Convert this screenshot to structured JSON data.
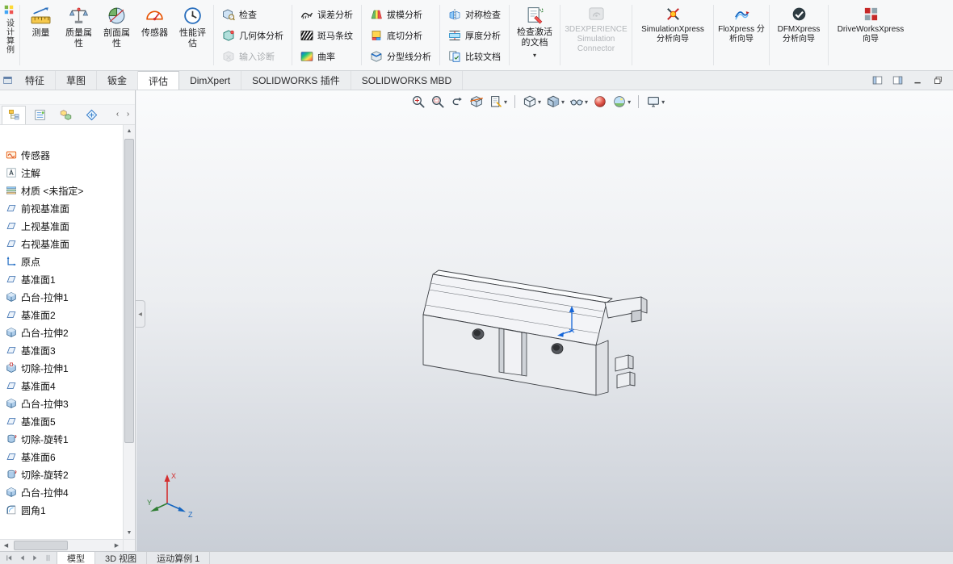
{
  "ribbon": {
    "design_study": {
      "label": "设计算例",
      "icon": "design-study"
    },
    "large_buttons": [
      {
        "label": "测量",
        "icon": "measure"
      },
      {
        "label": "质量属性",
        "icon": "mass-properties"
      },
      {
        "label": "剖面属性",
        "icon": "section-properties"
      },
      {
        "label": "传感器",
        "icon": "sensor"
      },
      {
        "label": "性能评估",
        "icon": "performance-evaluation"
      }
    ],
    "small_groups": [
      {
        "buttons": [
          {
            "label": "检查",
            "icon": "check-entity",
            "disabled": false
          },
          {
            "label": "几何体分析",
            "icon": "geometry-analysis",
            "disabled": false
          },
          {
            "label": "输入诊断",
            "icon": "import-diagnostics",
            "disabled": true
          }
        ]
      },
      {
        "buttons": [
          {
            "label": "误差分析",
            "icon": "deviation-analysis",
            "disabled": false
          },
          {
            "label": "斑马条纹",
            "icon": "zebra-stripes",
            "disabled": false
          },
          {
            "label": "曲率",
            "icon": "curvature",
            "disabled": false
          }
        ]
      },
      {
        "buttons": [
          {
            "label": "拔模分析",
            "icon": "draft-analysis",
            "disabled": false
          },
          {
            "label": "底切分析",
            "icon": "undercut-analysis",
            "disabled": false
          },
          {
            "label": "分型线分析",
            "icon": "parting-line-analysis",
            "disabled": false
          }
        ]
      },
      {
        "buttons": [
          {
            "label": "对称检查",
            "icon": "symmetry-check",
            "disabled": false
          },
          {
            "label": "厚度分析",
            "icon": "thickness-analysis",
            "disabled": false
          },
          {
            "label": "比较文档",
            "icon": "compare-documents",
            "disabled": false
          }
        ]
      }
    ],
    "check_active_document": {
      "label": "检查激活的文档",
      "icon": "check-active-document"
    },
    "wide_buttons": [
      {
        "label": "3DEXPERIENCE Simulation Connector",
        "icon": "threedexperience",
        "disabled": true
      },
      {
        "label": "SimulationXpress 分析向导",
        "icon": "simulationxpress",
        "disabled": false
      },
      {
        "label": "FloXpress 分析向导",
        "icon": "floxpress",
        "disabled": false
      },
      {
        "label": "DFMXpress 分析向导",
        "icon": "dfmxpress",
        "disabled": false
      },
      {
        "label": "DriveWorksXpress 向导",
        "icon": "driveworksxpress",
        "disabled": false
      }
    ]
  },
  "command_tabs": {
    "items": [
      {
        "label": "特征",
        "active": false
      },
      {
        "label": "草图",
        "active": false
      },
      {
        "label": "钣金",
        "active": false
      },
      {
        "label": "评估",
        "active": true
      },
      {
        "label": "DimXpert",
        "active": false
      },
      {
        "label": "SOLIDWORKS 插件",
        "active": false
      },
      {
        "label": "SOLIDWORKS MBD",
        "active": false
      }
    ],
    "window_controls": [
      {
        "icon": "pane-left"
      },
      {
        "icon": "pane-right"
      },
      {
        "icon": "minimize"
      },
      {
        "icon": "restore"
      }
    ]
  },
  "feature_tree": {
    "manager_tabs": [
      {
        "icon": "featuremanager",
        "active": true
      },
      {
        "icon": "propertymanager",
        "active": false
      },
      {
        "icon": "configurationmanager",
        "active": false
      },
      {
        "icon": "dimxpertmanager",
        "active": false
      }
    ],
    "nav_left": "‹",
    "nav_right": "›",
    "items": [
      {
        "label": "传感器",
        "icon": "sensors"
      },
      {
        "label": "注解",
        "icon": "annotations"
      },
      {
        "label": "材质 <未指定>",
        "icon": "material"
      },
      {
        "label": "前视基准面",
        "icon": "plane"
      },
      {
        "label": "上视基准面",
        "icon": "plane"
      },
      {
        "label": "右视基准面",
        "icon": "plane"
      },
      {
        "label": "原点",
        "icon": "origin"
      },
      {
        "label": "基准面1",
        "icon": "plane"
      },
      {
        "label": "凸台-拉伸1",
        "icon": "boss-extrude"
      },
      {
        "label": "基准面2",
        "icon": "plane"
      },
      {
        "label": "凸台-拉伸2",
        "icon": "boss-extrude"
      },
      {
        "label": "基准面3",
        "icon": "plane"
      },
      {
        "label": "切除-拉伸1",
        "icon": "cut-extrude"
      },
      {
        "label": "基准面4",
        "icon": "plane"
      },
      {
        "label": "凸台-拉伸3",
        "icon": "boss-extrude"
      },
      {
        "label": "基准面5",
        "icon": "plane"
      },
      {
        "label": "切除-旋转1",
        "icon": "cut-revolve"
      },
      {
        "label": "基准面6",
        "icon": "plane"
      },
      {
        "label": "切除-旋转2",
        "icon": "cut-revolve"
      },
      {
        "label": "凸台-拉伸4",
        "icon": "boss-extrude"
      },
      {
        "label": "圆角1",
        "icon": "fillet"
      }
    ]
  },
  "viewport": {
    "hud": [
      {
        "icon": "zoom-to-fit",
        "caret": false,
        "sep_after": false
      },
      {
        "icon": "zoom-to-area",
        "caret": false,
        "sep_after": false
      },
      {
        "icon": "previous-view",
        "caret": false,
        "sep_after": false
      },
      {
        "icon": "section-view",
        "caret": false,
        "sep_after": false
      },
      {
        "icon": "drawing-view",
        "caret": true,
        "sep_after": true
      },
      {
        "icon": "view-orientation",
        "caret": true,
        "sep_after": false
      },
      {
        "icon": "display-style",
        "caret": true,
        "sep_after": false
      },
      {
        "icon": "hide-show-items",
        "caret": true,
        "sep_after": false
      },
      {
        "icon": "edit-appearance",
        "caret": false,
        "sep_after": false
      },
      {
        "icon": "apply-scene",
        "caret": true,
        "sep_after": true
      },
      {
        "icon": "view-settings",
        "caret": true,
        "sep_after": false
      }
    ],
    "triad": {
      "x_label": "X",
      "y_label": "Y",
      "z_label": "Z"
    }
  },
  "bottom_bar": {
    "nav_icons": [
      "tab-first",
      "tab-prev",
      "tab-next",
      "tab-splitter"
    ],
    "tabs": [
      {
        "label": "模型",
        "active": true
      },
      {
        "label": "3D 视图",
        "active": false
      },
      {
        "label": "运动算例 1",
        "active": false
      }
    ]
  }
}
